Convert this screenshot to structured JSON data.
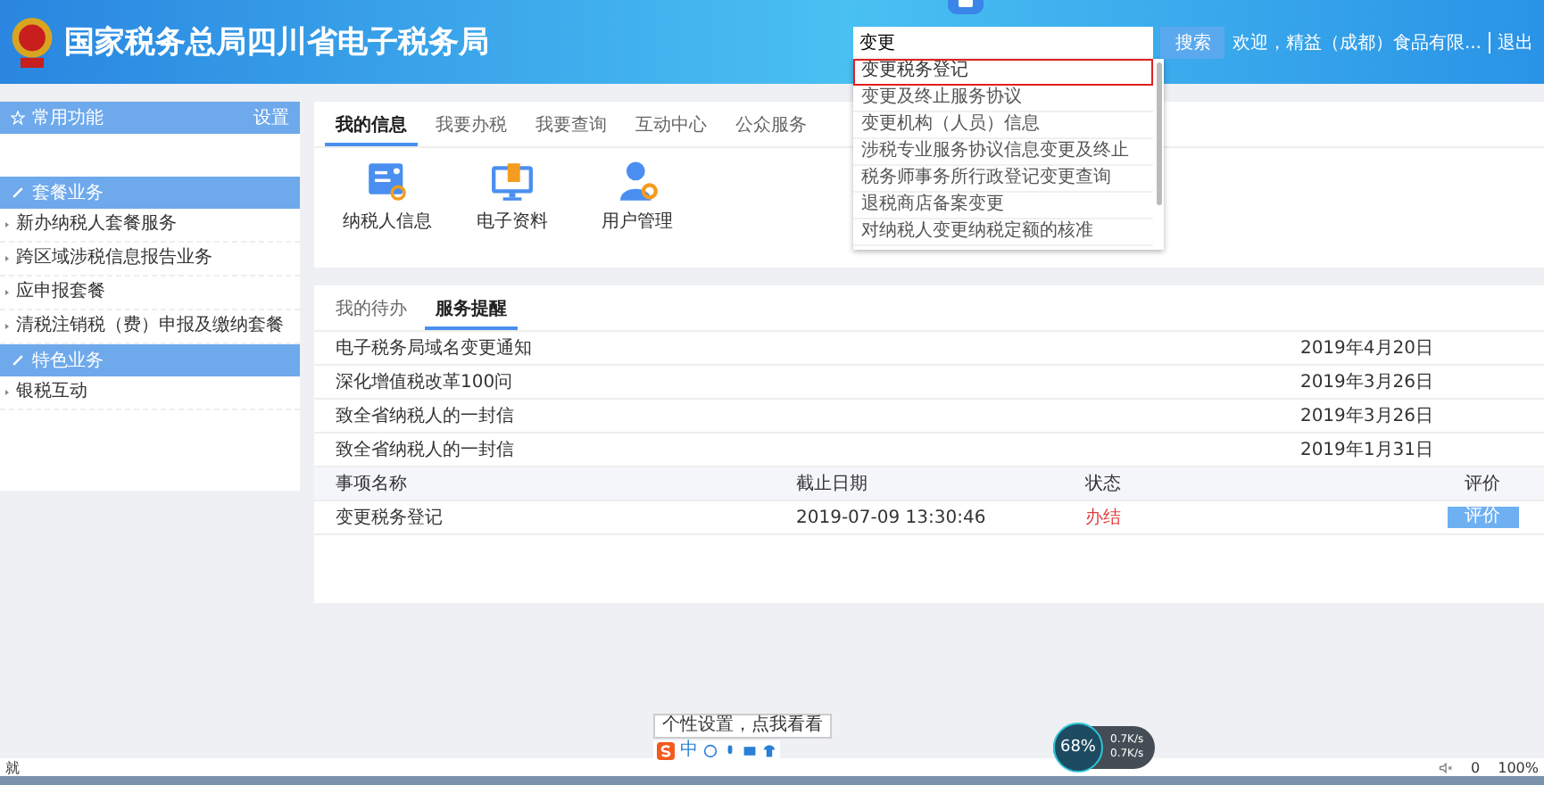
{
  "header": {
    "title": "国家税务总局四川省电子税务局",
    "search": {
      "value": "变更",
      "button": "搜索"
    },
    "welcome": "欢迎，精益（成都）食品有限...",
    "logout": "退出"
  },
  "search_suggestions": [
    {
      "label": "变更税务登记",
      "selected": true
    },
    {
      "label": "变更及终止服务协议",
      "selected": false
    },
    {
      "label": "变更机构（人员）信息",
      "selected": false
    },
    {
      "label": "涉税专业服务协议信息变更及终止",
      "selected": false
    },
    {
      "label": "税务师事务所行政登记变更查询",
      "selected": false
    },
    {
      "label": "退税商店备案变更",
      "selected": false
    },
    {
      "label": "对纳税人变更纳税定额的核准",
      "selected": false
    }
  ],
  "sidebar": {
    "common_title": "常用功能",
    "settings": "设置",
    "sections": [
      {
        "title": "套餐业务",
        "items": [
          "新办纳税人套餐服务",
          "跨区域涉税信息报告业务",
          "应申报套餐",
          "清税注销税（费）申报及缴纳套餐"
        ]
      },
      {
        "title": "特色业务",
        "items": [
          "银税互动"
        ]
      }
    ]
  },
  "main_tabs": [
    {
      "label": "我的信息",
      "selected": true
    },
    {
      "label": "我要办税",
      "selected": false
    },
    {
      "label": "我要查询",
      "selected": false
    },
    {
      "label": "互动中心",
      "selected": false
    },
    {
      "label": "公众服务",
      "selected": false
    }
  ],
  "quick_icons": [
    {
      "label": "纳税人信息",
      "kind": "taxpayer"
    },
    {
      "label": "电子资料",
      "kind": "documents"
    },
    {
      "label": "用户管理",
      "kind": "user"
    }
  ],
  "sub_tabs": [
    {
      "label": "我的待办",
      "selected": false
    },
    {
      "label": "服务提醒",
      "selected": true
    }
  ],
  "notices": [
    {
      "title": "电子税务局域名变更通知",
      "date": "2019年4月20日"
    },
    {
      "title": "深化增值税改革100问",
      "date": "2019年3月26日"
    },
    {
      "title": "致全省纳税人的一封信",
      "date": "2019年3月26日"
    },
    {
      "title": "致全省纳税人的一封信",
      "date": "2019年1月31日"
    }
  ],
  "table": {
    "columns": [
      "事项名称",
      "截止日期",
      "状态",
      "评价"
    ],
    "rows": [
      {
        "name": "变更税务登记",
        "deadline": "2019-07-09 13:30:46",
        "status": "办结",
        "action": "评价"
      }
    ]
  },
  "ime": {
    "tooltip": "个性设置，点我看看",
    "mode": "中"
  },
  "network": {
    "percent": "68%",
    "upload": "0.7K/s",
    "download": "0.7K/s"
  },
  "status_bar": {
    "left": "就",
    "messages": "0",
    "zoom": "100%"
  }
}
